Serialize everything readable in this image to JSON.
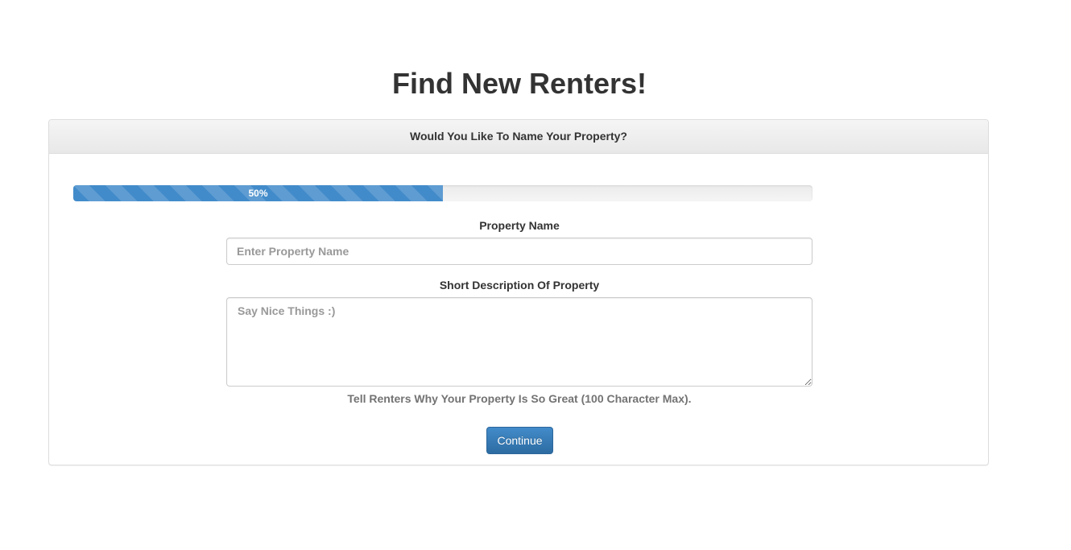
{
  "page": {
    "title": "Find New Renters!"
  },
  "panel": {
    "heading": "Would You Like To Name Your Property?"
  },
  "progress": {
    "value_percent": 50,
    "label": "50%",
    "color": "#428bca"
  },
  "form": {
    "property_name_label": "Property Name",
    "property_name_placeholder": "Enter Property Name",
    "property_name_value": "",
    "description_label": "Short Description Of Property",
    "description_placeholder": "Say Nice Things :)",
    "description_value": "",
    "help_text": "Tell Renters Why Your Property Is So Great (100 Character Max).",
    "continue_label": "Continue"
  }
}
